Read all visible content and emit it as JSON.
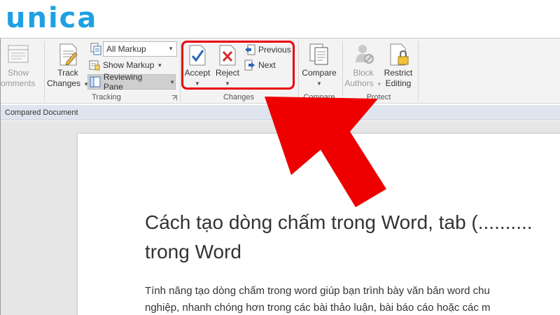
{
  "logo": {
    "text": "unica"
  },
  "ribbon": {
    "comments_group": {
      "show_comments_line1": "Show",
      "show_comments_line2": "omments"
    },
    "tracking": {
      "label": "Tracking",
      "track_changes_line1": "Track",
      "track_changes_line2": "Changes",
      "markup_select_value": "All Markup",
      "show_markup_label": "Show Markup",
      "reviewing_pane_label": "Reviewing Pane"
    },
    "changes": {
      "label": "Changes",
      "accept_label": "Accept",
      "reject_label": "Reject",
      "previous_label": "Previous",
      "next_label": "Next"
    },
    "compare": {
      "label": "Compare",
      "compare_label": "Compare"
    },
    "protect": {
      "label": "Protect",
      "block_authors_line1": "Block",
      "block_authors_line2": "Authors",
      "restrict_editing_line1": "Restrict",
      "restrict_editing_line2": "Editing"
    }
  },
  "compared_bar": {
    "text": "Compared Document"
  },
  "document": {
    "title_line1": "Cách tạo dòng chấm trong Word, tab (..........",
    "title_line2": "trong Word",
    "body_line1": "Tính năng tạo dòng chấm trong word giúp bạn trình bày văn bản word chu",
    "body_line2": "nghiệp, nhanh chóng hơn trong các bài thảo luận, bài báo cáo hoặc các m"
  },
  "colors": {
    "logo": "#1da1e2",
    "highlight": "#e8000b",
    "arrow": "#ee0000",
    "ribbon_bg": "#f3f3f3"
  },
  "icons": [
    "show-comments-icon",
    "track-changes-icon",
    "markup-icon",
    "show-markup-icon",
    "reviewing-pane-icon",
    "accept-check-icon",
    "reject-x-icon",
    "previous-icon",
    "next-icon",
    "compare-icon",
    "block-authors-icon",
    "restrict-editing-lock-icon",
    "dialog-launcher-icon"
  ]
}
